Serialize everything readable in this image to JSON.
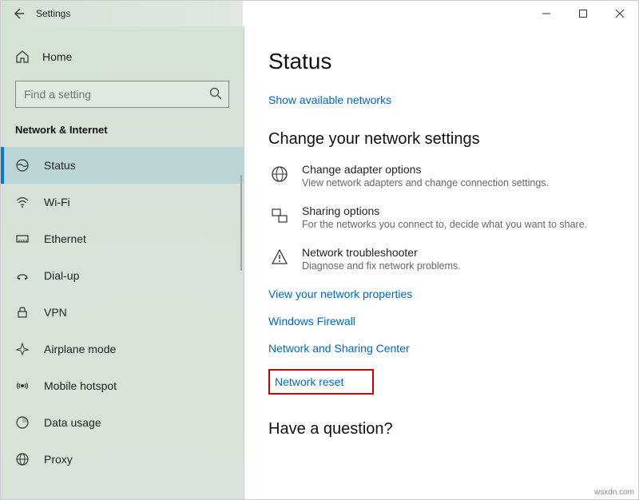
{
  "titlebar": {
    "title": "Settings"
  },
  "sidebar": {
    "home_label": "Home",
    "search_placeholder": "Find a setting",
    "section_label": "Network & Internet",
    "items": [
      {
        "label": "Status"
      },
      {
        "label": "Wi-Fi"
      },
      {
        "label": "Ethernet"
      },
      {
        "label": "Dial-up"
      },
      {
        "label": "VPN"
      },
      {
        "label": "Airplane mode"
      },
      {
        "label": "Mobile hotspot"
      },
      {
        "label": "Data usage"
      },
      {
        "label": "Proxy"
      }
    ]
  },
  "content": {
    "heading": "Status",
    "show_networks_link": "Show available networks",
    "change_settings_heading": "Change your network settings",
    "options": [
      {
        "title": "Change adapter options",
        "desc": "View network adapters and change connection settings."
      },
      {
        "title": "Sharing options",
        "desc": "For the networks you connect to, decide what you want to share."
      },
      {
        "title": "Network troubleshooter",
        "desc": "Diagnose and fix network problems."
      }
    ],
    "links": [
      "View your network properties",
      "Windows Firewall",
      "Network and Sharing Center",
      "Network reset"
    ],
    "question_heading": "Have a question?"
  },
  "watermark": "wsxdn.com"
}
